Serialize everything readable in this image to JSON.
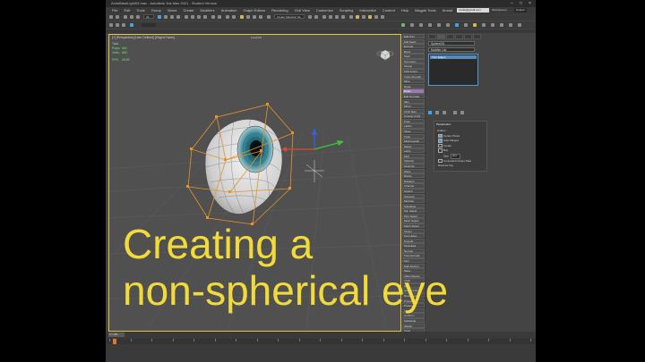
{
  "window": {
    "title": "AnimBaseLight03.max - Autodesk 3ds Max 2021 - Student Version"
  },
  "menu": {
    "items": [
      "File",
      "Edit",
      "Tools",
      "Group",
      "Views",
      "Create",
      "Modifiers",
      "Animation",
      "Graph Editors",
      "Rendering",
      "Civil View",
      "Customize",
      "Scripting",
      "Interactive",
      "Content",
      "Help",
      "Magpie Tools",
      "Arnold"
    ],
    "user": "rwolfe@gmail.com",
    "workspace_label": "Workspaces:",
    "workspace_value": "Default"
  },
  "toolbar": {
    "selection_filter": "All",
    "named_selection": "Create Selection Se"
  },
  "viewport": {
    "label": "[+] [Perspective] [User Defined] [Edged Faces]",
    "object_name": "FreeFFD",
    "stats": [
      {
        "label": "Total",
        "value": ""
      },
      {
        "label": "Polys:",
        "value": "662"
      },
      {
        "label": "Verts:",
        "value": "660"
      },
      {
        "label": "FPS:",
        "value": "28.59"
      }
    ]
  },
  "command_column": {
    "items": [
      "Edit Poly",
      "Edit Mesh",
      "Extrude",
      "Bend",
      "Shell",
      "Symmetry",
      "Sweep",
      "FFD 4x4x4",
      "Turbo Smooth",
      "Slice",
      "Noise",
      "Relax",
      "Edit Normals",
      "Skin",
      "Mirror",
      "UVW Map",
      "Unwrap UVW",
      "Push",
      "Lattice",
      "Taper",
      "Twist",
      "Meshsmooth",
      "Select",
      "Lathe",
      "Melt",
      "Spherify",
      "Optimize",
      "Wave",
      "Ripple",
      "Displace",
      "Chamfer",
      "Stretch",
      "Squeeze",
      "Morpher",
      "Substitute",
      "Vol. Select",
      "Poly Select",
      "Mesh Select",
      "Patch Select",
      "XForm",
      "Cap Holes",
      "Smooth",
      "Tessellate",
      "Normal",
      "Face Extrude",
      "Flex",
      "Path Deform",
      "Skew",
      "Affect Region",
      "Cloth",
      "Hair",
      "Quad Chamfer",
      "Retopology",
      "Projection",
      "Preserve",
      "Unwrap",
      "Conform",
      "Subdivide",
      "Welder",
      "Tools",
      "Rotate Pro"
    ],
    "active_index": 11
  },
  "panel": {
    "object_name": "Sphere001",
    "modifier_list": "Modifier List",
    "stack_items": [
      "Turn Edges"
    ],
    "rollout_title": "Parameters",
    "lines": [
      {
        "kind": "head",
        "text": "Hidden"
      },
      {
        "kind": "chk",
        "on": true,
        "text": "Center Pivots"
      },
      {
        "kind": "chk",
        "on": true,
        "text": "Auto Flipped"
      },
      {
        "kind": "chk",
        "on": false,
        "text": "Create"
      },
      {
        "kind": "chk",
        "on": false,
        "text": "Box"
      },
      {
        "kind": "num",
        "text": "Size",
        "value": "30.0"
      },
      {
        "kind": "chk",
        "on": false,
        "text": "Connected Vertex Data"
      },
      {
        "kind": "plain",
        "text": "Draw As Top"
      }
    ]
  },
  "timeline": {
    "slider": "0 / 100"
  },
  "caption": {
    "line1": "Creating a",
    "line2": "non-spherical eye"
  },
  "colors": {
    "caption": "#f2da3a",
    "lattice": "#e8922a",
    "selection_stack": "#5b88b4",
    "active_button": "#9a7ab0"
  }
}
